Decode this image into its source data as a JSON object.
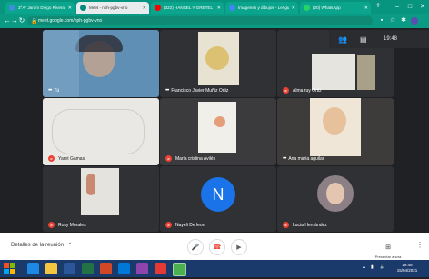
{
  "browser": {
    "tabs": [
      {
        "title": "3°A\" Jardín Diego Rivera Tel: l",
        "favicon_color": "#3c8edc"
      },
      {
        "title": "Meet - nph-pgbv-vno",
        "favicon_color": "#00897b"
      },
      {
        "title": "(322) HANSEL Y GRETEL (El)",
        "favicon_color": "#ff0000"
      },
      {
        "title": "Imágenes y dibujos - Lenguaje",
        "favicon_color": "#4285f4"
      },
      {
        "title": "(20) WhatsApp",
        "favicon_color": "#25d366"
      }
    ],
    "active_tab": 1,
    "url": "meet.google.com/nph-pgbv-vno"
  },
  "meet": {
    "time": "19:48",
    "participants": [
      {
        "name": "Tú",
        "muted": false
      },
      {
        "name": "Francisco Javier Muñiz Ortiz",
        "muted": false
      },
      {
        "name": "Alma ruy Ortiz",
        "muted": true
      },
      {
        "name": "Yaret Gamas",
        "muted": true
      },
      {
        "name": "Maria cristina Avilés",
        "muted": true
      },
      {
        "name": "Ana maria aguilar",
        "muted": false
      },
      {
        "name": "Rosy Morales",
        "muted": true
      },
      {
        "name": "Nayeli De leon",
        "muted": true
      },
      {
        "name": "Lucia Hernández",
        "muted": true
      }
    ],
    "avatar_letter": "N",
    "details_label": "Detalles de la reunión",
    "present_label": "Presentar ahora"
  },
  "taskbar": {
    "time": "19:48",
    "date": "15/04/2021"
  },
  "colors": {
    "browser_bar": "#08957f",
    "meet_bg": "#202124",
    "mute_red": "#ea4335",
    "avatar_blue": "#1a73e8"
  }
}
